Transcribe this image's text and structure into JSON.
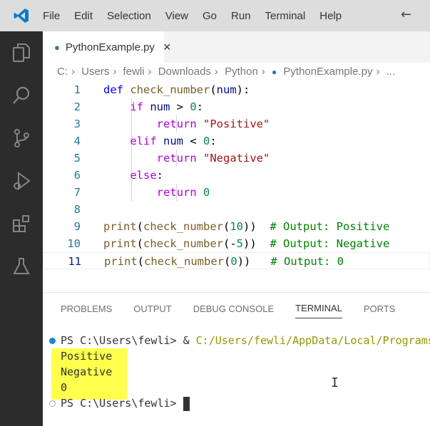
{
  "menu": [
    "File",
    "Edit",
    "Selection",
    "View",
    "Go",
    "Run",
    "Terminal",
    "Help"
  ],
  "tab": {
    "label": "PythonExample.py",
    "close": "×"
  },
  "breadcrumb": [
    "C:",
    "Users",
    "fewli",
    "Downloads",
    "Python",
    "PythonExample.py",
    "..."
  ],
  "code": {
    "line_numbers": [
      "1",
      "2",
      "3",
      "4",
      "5",
      "6",
      "7",
      "8",
      "9",
      "10",
      "11"
    ]
  },
  "panel": {
    "tabs": [
      "PROBLEMS",
      "OUTPUT",
      "DEBUG CONSOLE",
      "TERMINAL",
      "PORTS"
    ],
    "active": "TERMINAL"
  },
  "terminal": {
    "prompt": "PS C:\\Users\\fewli>",
    "cmd_amp": " & ",
    "cmd_path": "C:/Users/fewli/AppData/Local/Programs",
    "output": [
      "Positive",
      "Negative",
      "0"
    ]
  },
  "colors": {
    "accent": "#007acc",
    "highlight": "#ffff4d"
  }
}
